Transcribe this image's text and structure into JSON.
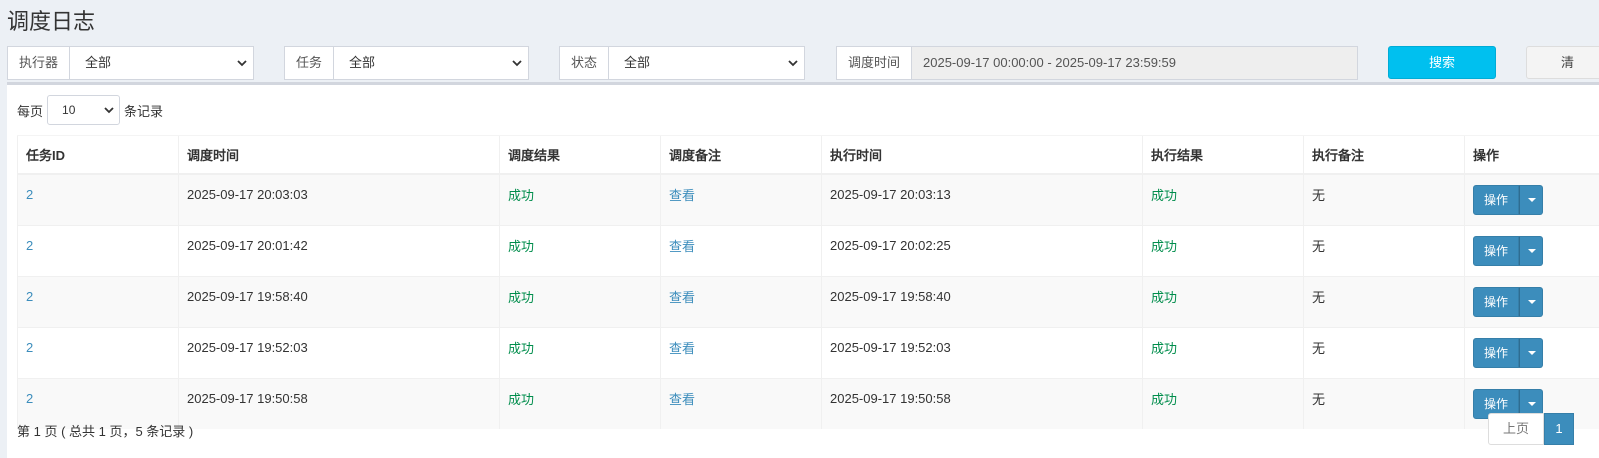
{
  "page": {
    "title": "调度日志"
  },
  "filters": {
    "executor": {
      "label": "执行器",
      "value": "全部"
    },
    "job": {
      "label": "任务",
      "value": "全部"
    },
    "status": {
      "label": "状态",
      "value": "全部"
    },
    "time": {
      "label": "调度时间",
      "value": "2025-09-17 00:00:00 - 2025-09-17 23:59:59"
    },
    "search_label": "搜索",
    "clear_label": "清"
  },
  "paging_top": {
    "prefix": "每页",
    "page_size": "10",
    "suffix": "条记录"
  },
  "table": {
    "headers": [
      "任务ID",
      "调度时间",
      "调度结果",
      "调度备注",
      "执行时间",
      "执行结果",
      "执行备注",
      "操作"
    ],
    "rows": [
      {
        "job_id": "2",
        "trigger_time": "2025-09-17 20:03:03",
        "trigger_result": "成功",
        "trigger_note": "查看",
        "handle_time": "2025-09-17 20:03:13",
        "handle_result": "成功",
        "handle_note": "无",
        "action": "操作"
      },
      {
        "job_id": "2",
        "trigger_time": "2025-09-17 20:01:42",
        "trigger_result": "成功",
        "trigger_note": "查看",
        "handle_time": "2025-09-17 20:02:25",
        "handle_result": "成功",
        "handle_note": "无",
        "action": "操作"
      },
      {
        "job_id": "2",
        "trigger_time": "2025-09-17 19:58:40",
        "trigger_result": "成功",
        "trigger_note": "查看",
        "handle_time": "2025-09-17 19:58:40",
        "handle_result": "成功",
        "handle_note": "无",
        "action": "操作"
      },
      {
        "job_id": "2",
        "trigger_time": "2025-09-17 19:52:03",
        "trigger_result": "成功",
        "trigger_note": "查看",
        "handle_time": "2025-09-17 19:52:03",
        "handle_result": "成功",
        "handle_note": "无",
        "action": "操作"
      },
      {
        "job_id": "2",
        "trigger_time": "2025-09-17 19:50:58",
        "trigger_result": "成功",
        "trigger_note": "查看",
        "handle_time": "2025-09-17 19:50:58",
        "handle_result": "成功",
        "handle_note": "无",
        "action": "操作"
      }
    ]
  },
  "footer": {
    "summary": "第 1 页 ( 总共 1 页，5 条记录 )",
    "prev_label": "上页",
    "current_page": "1"
  },
  "icons": {
    "select_caret": "chevron-down-icon",
    "action_caret": "caret-down-icon"
  },
  "colors": {
    "primary": "#3c8dbc",
    "info": "#00c0ef",
    "success": "#008d4c",
    "background": "#ecf0f5"
  }
}
